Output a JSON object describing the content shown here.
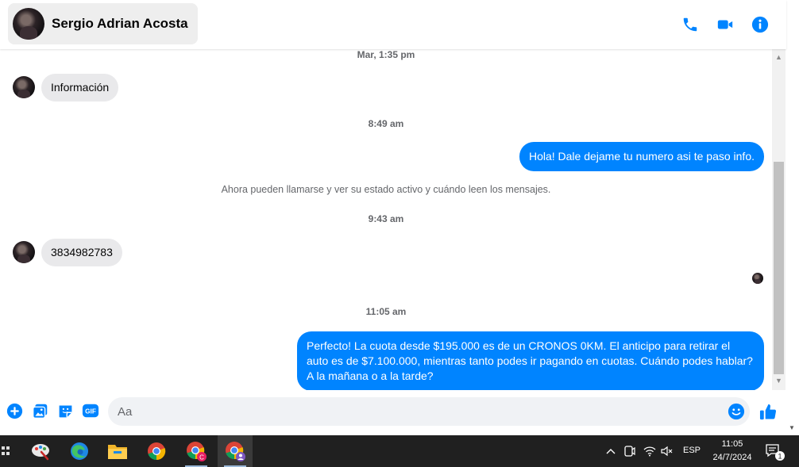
{
  "header": {
    "contact_name": "Sergio Adrian Acosta"
  },
  "messages": {
    "ts1": "Mar, 1:35 pm",
    "msg1": "Información",
    "ts2": "8:49 am",
    "msg2": "Hola! Dale dejame tu numero  asi te paso info.",
    "notice": "Ahora pueden llamarse y ver su estado activo y cuándo leen los mensajes.",
    "ts3": "9:43 am",
    "msg3": "3834982783",
    "ts4": "11:05 am",
    "msg4": "Perfecto! La cuota desde $195.000 es de un CRONOS 0KM. El anticipo para retirar el auto es de $7.100.000, mientras tanto podes ir pagando en cuotas. Cuándo podes hablar? A la mañana o a la tarde?"
  },
  "composer": {
    "placeholder": "Aa",
    "gif_label": "GIF"
  },
  "taskbar": {
    "lang": "ESP",
    "time": "11:05",
    "date": "24/7/2024",
    "notif_count": "1"
  },
  "colors": {
    "accent": "#0084ff",
    "incoming_bubble": "#e9e9eb",
    "taskbar": "#202020"
  }
}
